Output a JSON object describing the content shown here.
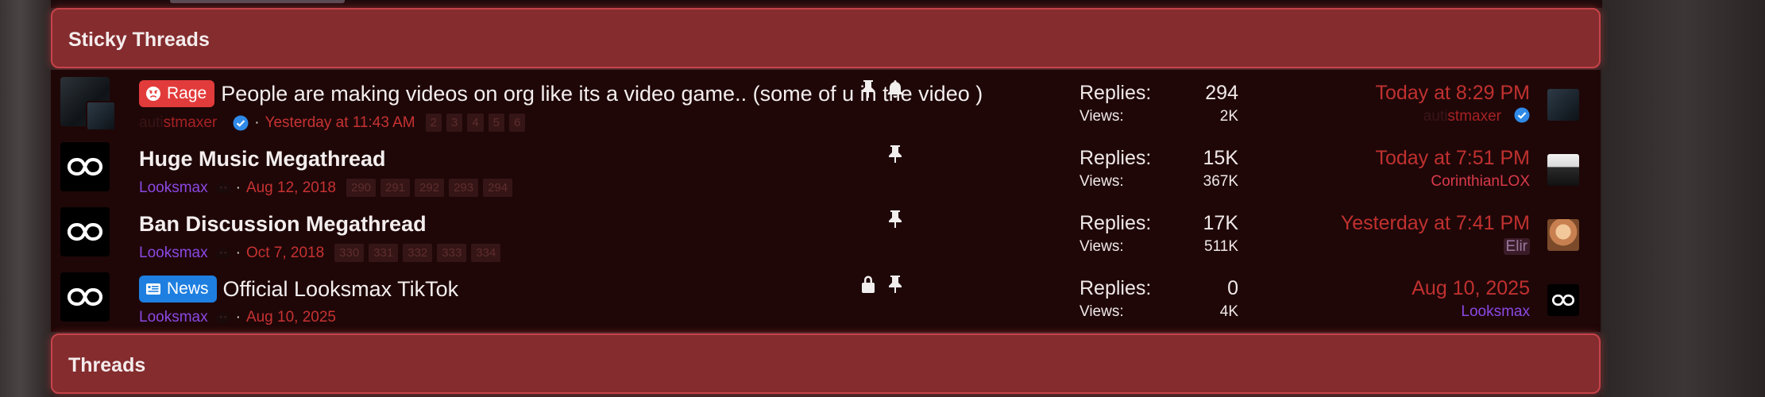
{
  "sections": {
    "sticky_title": "Sticky Threads",
    "threads_title": "Threads"
  },
  "labels": {
    "replies": "Replies:",
    "views": "Views:"
  },
  "colors": {
    "header_bg": "#842c2e",
    "body_bg": "#1f0708",
    "accent_red": "#c0312f",
    "username_purple": "#8b48e3",
    "prefix_rage": "#e23b3b",
    "prefix_news": "#1f7fe0"
  },
  "threads": [
    {
      "prefix": "Rage",
      "prefix_icon": "angry-face-icon",
      "title": "People are making videos on org like its a video game.. (some of u in the video )",
      "author_a": "auti",
      "author_b": "stmaxer",
      "date": "Yesterday at 11:43 AM",
      "pages": [
        "2",
        "3",
        "4",
        "5",
        "6"
      ],
      "icons": [
        "pin-icon",
        "bell-icon"
      ],
      "replies": "294",
      "views": "2K",
      "last_date": "Today at 8:29 PM",
      "last_user_a": "auti",
      "last_user_b": "stmaxer"
    },
    {
      "title": "Huge Music Megathread",
      "author": "Looksmax",
      "date": "Aug 12, 2018",
      "pages": [
        "290",
        "291",
        "292",
        "293",
        "294"
      ],
      "icons": [
        "pin-icon"
      ],
      "replies": "15K",
      "views": "367K",
      "last_date": "Today at 7:51 PM",
      "last_user": "CorinthianLOX"
    },
    {
      "title": "Ban Discussion Megathread",
      "author": "Looksmax",
      "date": "Oct 7, 2018",
      "pages": [
        "330",
        "331",
        "332",
        "333",
        "334"
      ],
      "icons": [
        "pin-icon"
      ],
      "replies": "17K",
      "views": "511K",
      "last_date": "Yesterday at 7:41 PM",
      "last_user": "Elir"
    },
    {
      "prefix": "News",
      "prefix_icon": "newspaper-icon",
      "title": "Official Looksmax TikTok",
      "author": "Looksmax",
      "date": "Aug 10, 2025",
      "icons": [
        "lock-icon",
        "pin-icon"
      ],
      "replies": "0",
      "views": "4K",
      "last_date": "Aug 10, 2025",
      "last_user": "Looksmax"
    }
  ]
}
